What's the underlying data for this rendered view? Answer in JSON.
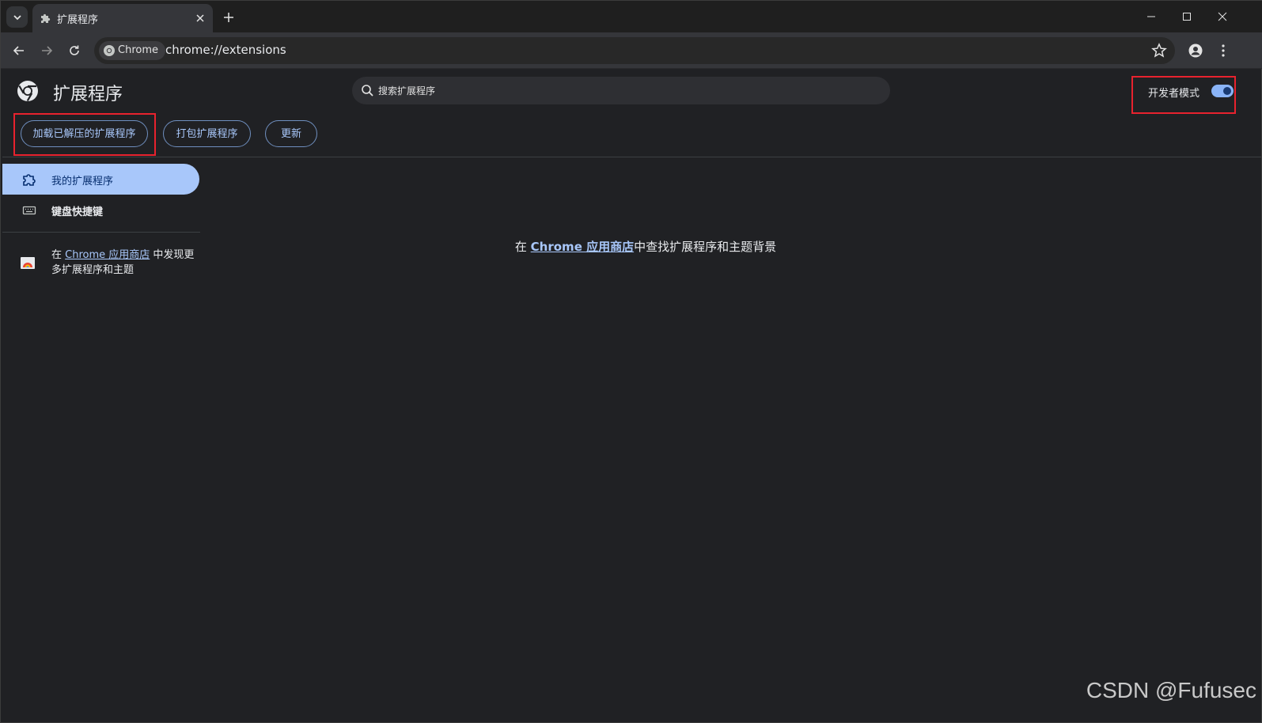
{
  "tab": {
    "title": "扩展程序"
  },
  "toolbar": {
    "security_chip": "Chrome",
    "url": "chrome://extensions"
  },
  "header": {
    "title": "扩展程序",
    "search_placeholder": "搜索扩展程序",
    "devmode_label": "开发者模式",
    "devmode_enabled": true
  },
  "actions": {
    "load_unpacked": "加载已解压的扩展程序",
    "pack": "打包扩展程序",
    "update": "更新"
  },
  "sidebar": {
    "items": [
      {
        "label": "我的扩展程序",
        "icon": "puzzle-icon",
        "active": true
      },
      {
        "label": "键盘快捷键",
        "icon": "keyboard-icon",
        "active": false
      }
    ],
    "promo_prefix": "在 ",
    "promo_link": "Chrome 应用商店",
    "promo_suffix": " 中发现更多扩展程序和主题"
  },
  "main": {
    "empty_prefix": "在 ",
    "empty_link": "Chrome 应用商店",
    "empty_suffix": "中查找扩展程序和主题背景"
  },
  "watermark": "CSDN @Fufusec",
  "colors": {
    "accent": "#a8c7fa",
    "background": "#202124",
    "highlight_box": "#e8222e"
  }
}
